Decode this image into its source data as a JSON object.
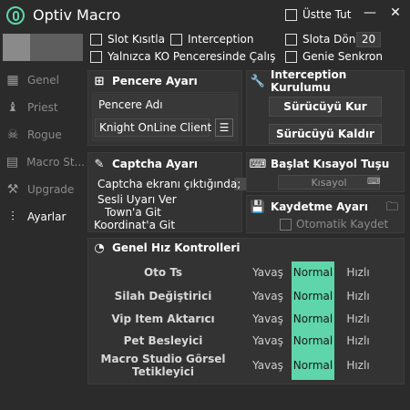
{
  "app": {
    "title": "Optiv Macro"
  },
  "window": {
    "always_on_top_label": "Üstte Tut",
    "minimize_glyph": "—",
    "close_glyph": "✕"
  },
  "options": {
    "slot_limit": "Slot Kısıtla",
    "interception": "Interception",
    "slot_return": "Slota Dön",
    "slot_return_value": "20",
    "only_ko_window": "Yalnızca KO Penceresinde Çalış",
    "genie_sync": "Genie Senkron"
  },
  "sidebar": {
    "items": [
      {
        "label": "Genel",
        "icon": "grid-icon"
      },
      {
        "label": "Priest",
        "icon": "priest-icon"
      },
      {
        "label": "Rogue",
        "icon": "rogue-icon"
      },
      {
        "label": "Macro St...",
        "icon": "clapper-icon"
      },
      {
        "label": "Upgrade",
        "icon": "anvil-icon"
      },
      {
        "label": "Ayarlar",
        "icon": "sliders-icon"
      }
    ]
  },
  "window_settings": {
    "title": "Pencere Ayarı",
    "window_name_label": "Pencere Adı",
    "window_name_value": "Knight OnLine Client"
  },
  "interception_setup": {
    "title": "Interception Kurulumu",
    "install_button": "Sürücüyü Kur",
    "remove_button": "Sürücüyü Kaldır"
  },
  "captcha": {
    "title": "Captcha Ayarı",
    "when_appears": "Captcha ekranı çıktığında;",
    "sound_alert": "Sesli Uyarı Ver",
    "go_town": "Town'a Git",
    "go_coordinate": "Koordinat'a Git"
  },
  "start_hotkey": {
    "title": "Başlat Kısayol Tuşu",
    "hotkey_placeholder": "Kısayol"
  },
  "save_settings": {
    "title": "Kaydetme Ayarı",
    "auto_save": "Otomatik Kaydet"
  },
  "speed": {
    "title": "Genel Hız Kontrolleri",
    "options": {
      "slow": "Yavaş",
      "normal": "Normal",
      "fast": "Hızlı"
    },
    "rows": [
      {
        "label": "Oto Ts"
      },
      {
        "label": "Silah Değiştirici"
      },
      {
        "label": "Vip Item Aktarıcı"
      },
      {
        "label": "Pet Besleyici"
      },
      {
        "label": "Macro Studio Görsel Tetikleyici"
      }
    ]
  },
  "colors": {
    "accent": "#5ed5aa",
    "panel": "#333333",
    "background": "#2b2b2b"
  }
}
